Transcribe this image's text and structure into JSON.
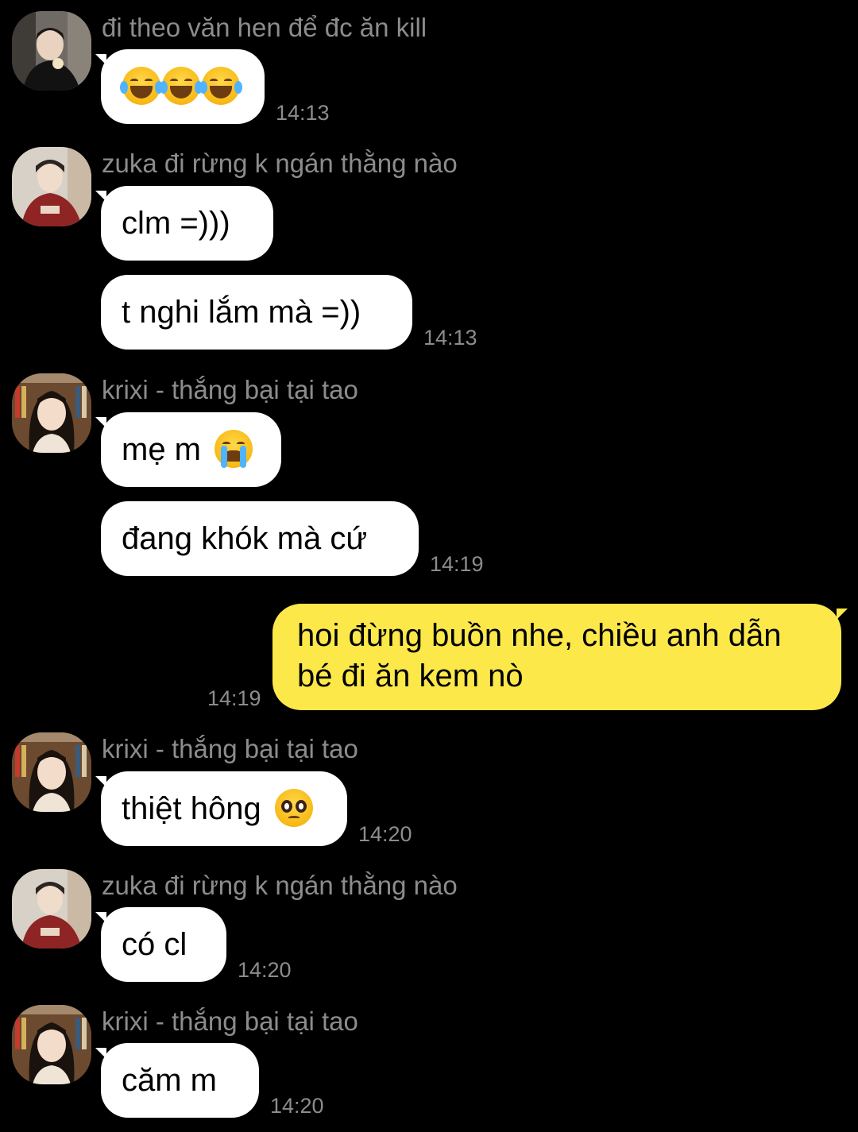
{
  "colors": {
    "background": "#000000",
    "incoming_bubble": "#ffffff",
    "outgoing_bubble": "#fde84a",
    "meta_text": "#8c8c8c"
  },
  "messages": {
    "m1": {
      "sender": "đi theo văn hen để đc ăn kill",
      "emoji": "😂😂😂",
      "time": "14:13"
    },
    "m2": {
      "sender": "zuka đi rừng k ngán thằng nào",
      "line1": "clm =)))",
      "line2": "t nghi lắm mà =))",
      "time": "14:13"
    },
    "m3": {
      "sender": "krixi - thắng bại tại tao",
      "line1_text": "mẹ m",
      "line1_emoji": "😭",
      "line2": "đang khók mà cứ",
      "time": "14:19"
    },
    "m4": {
      "line1": "hoi đừng buồn nhe, chiều anh dẫn",
      "line2": "bé đi ăn kem nò",
      "time": "14:19"
    },
    "m5": {
      "sender": "krixi - thắng bại tại tao",
      "text": "thiệt hông",
      "emoji": "🥺",
      "time": "14:20"
    },
    "m6": {
      "sender": "zuka đi rừng k ngán thằng nào",
      "text": "có cl",
      "time": "14:20"
    },
    "m7": {
      "sender": "krixi - thắng bại tại tao",
      "text": "căm m",
      "time": "14:20"
    }
  }
}
